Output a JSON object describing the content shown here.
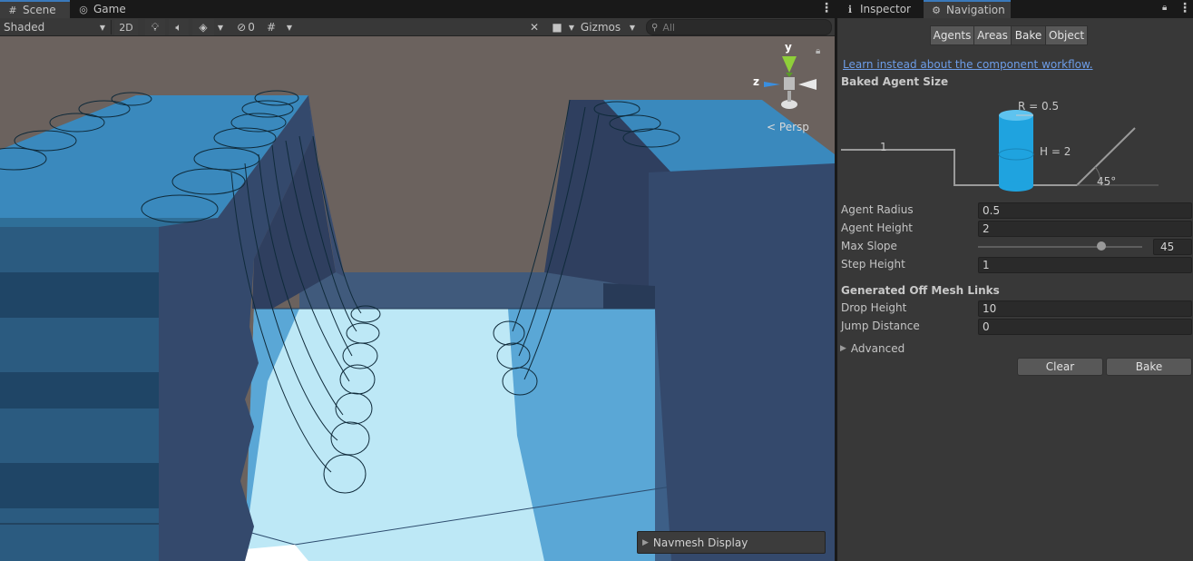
{
  "scene_window": {
    "tabs": [
      {
        "label": "Scene",
        "icon": "grid-icon",
        "active": true
      },
      {
        "label": "Game",
        "icon": "gamepad-icon",
        "active": false
      }
    ],
    "toolbar": {
      "shading_mode": "Shaded",
      "mode_2d_label": "2D",
      "hidden_objects_count": "0",
      "gizmos_label": "Gizmos",
      "search_placeholder": "All"
    },
    "viewport": {
      "axis_labels": {
        "y": "y",
        "z": "z"
      },
      "projection_label": "Persp",
      "navmesh_display_label": "Navmesh Display"
    }
  },
  "inspector_window": {
    "tabs": [
      {
        "label": "Inspector",
        "icon": "info-icon",
        "active": false
      },
      {
        "label": "Navigation",
        "icon": "navigation-icon",
        "active": true
      }
    ],
    "navigation": {
      "segments": [
        {
          "label": "Agents",
          "selected": false
        },
        {
          "label": "Areas",
          "selected": false
        },
        {
          "label": "Bake",
          "selected": true
        },
        {
          "label": "Object",
          "selected": false
        }
      ],
      "workflow_link": "Learn instead about the component workflow.",
      "baked_agent_size": {
        "title": "Baked Agent Size",
        "diagram": {
          "radius_label": "R = 0.5",
          "height_label": "H = 2",
          "step_label": "1",
          "slope_label": "45°"
        }
      },
      "fields": {
        "agent_radius": {
          "label": "Agent Radius",
          "value": "0.5"
        },
        "agent_height": {
          "label": "Agent Height",
          "value": "2"
        },
        "max_slope": {
          "label": "Max Slope",
          "value": "45",
          "fraction": 0.75
        },
        "step_height": {
          "label": "Step Height",
          "value": "1"
        }
      },
      "off_mesh_links": {
        "title": "Generated Off Mesh Links",
        "drop_height": {
          "label": "Drop Height",
          "value": "10"
        },
        "jump_distance": {
          "label": "Jump Distance",
          "value": "0"
        }
      },
      "advanced_label": "Advanced",
      "buttons": {
        "clear": "Clear",
        "bake": "Bake"
      }
    }
  },
  "colors": {
    "accent": "#3a79bb",
    "link": "#6d9de8",
    "navmesh": "#2a8fd6",
    "agent_cylinder": "#1fa3df"
  }
}
